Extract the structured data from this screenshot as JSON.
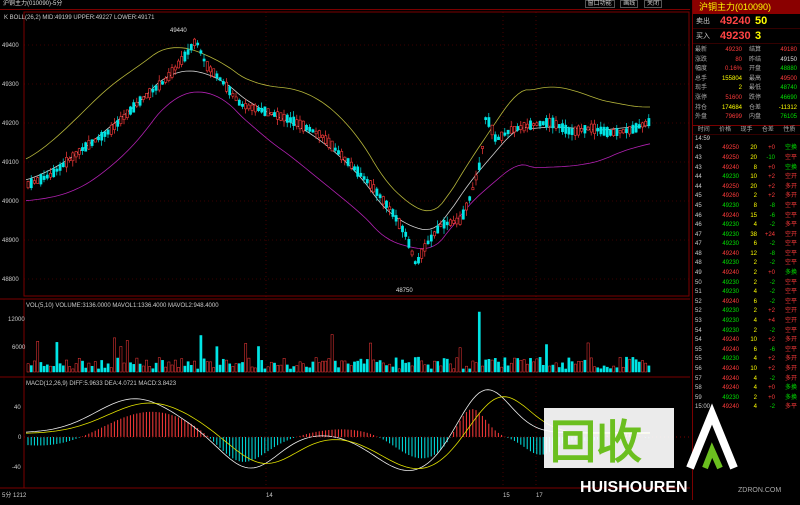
{
  "window": {
    "title": "沪铜主力(010090)-5分",
    "buttons": [
      "窗口功能",
      "画线",
      "关闭"
    ]
  },
  "main_chart": {
    "indicator_label": "K  BOLL(26,2) MID:49199 UPPER:49227 LOWER:49171",
    "y_ticks": [
      "49400",
      "49300",
      "49200",
      "49100",
      "49000",
      "48900",
      "48800"
    ],
    "high_label": "49440",
    "low_label": "48750"
  },
  "volume_chart": {
    "indicator_label": "VOL(5,10) VOLUME:3136.0000 MAVOL1:1336.4000 MAVOL2:948.4000",
    "y_ticks": [
      "12000",
      "6000"
    ]
  },
  "macd_chart": {
    "indicator_label": "MACD(12,26,9) DIFF:5.9633 DEA:4.0721 MACD:3.8423",
    "y_ticks": [
      "40",
      "0",
      "-40"
    ]
  },
  "x_axis": {
    "labels": [
      "5分 1212",
      "14",
      "15",
      "17"
    ]
  },
  "colors": {
    "up": "#ff3b3b",
    "down": "#00e5e5",
    "mid": "#d0d0d0",
    "upper": "#b5b53a",
    "lower": "#b020b0",
    "grid": "#7a0000",
    "accent": "#8a0000"
  },
  "panel": {
    "title": "沪铜主力(010090)",
    "sell": {
      "label": "卖出",
      "price": "49240",
      "vol": "50"
    },
    "buy": {
      "label": "买入",
      "price": "49230",
      "vol": "3"
    },
    "stats": [
      [
        "最新",
        "49230",
        "结算",
        "49180"
      ],
      [
        "涨跌",
        "80",
        "昨结",
        "49150"
      ],
      [
        "幅度",
        "0.16%",
        "开盘",
        "48880"
      ],
      [
        "总手",
        "155804",
        "最高",
        "49500"
      ],
      [
        "现手",
        "2",
        "最低",
        "48740"
      ],
      [
        "涨停",
        "51600",
        "跌停",
        "46690"
      ],
      [
        "持仓",
        "174684",
        "仓差",
        "-11312"
      ],
      [
        "外盘",
        "79699",
        "内盘",
        "76105"
      ]
    ],
    "ticks_header": [
      "时间",
      "价格",
      "现手",
      "仓差",
      "性质"
    ],
    "ticks": [
      [
        "14:59",
        "",
        "",
        "",
        ""
      ],
      [
        "43",
        "49250",
        "20",
        "+0",
        "空换"
      ],
      [
        "43",
        "49250",
        "20",
        "-10",
        "空平"
      ],
      [
        "43",
        "49240",
        "8",
        "+0",
        "空换"
      ],
      [
        "44",
        "49230",
        "10",
        "+2",
        "空开"
      ],
      [
        "44",
        "49250",
        "20",
        "+2",
        "多开"
      ],
      [
        "45",
        "49260",
        "2",
        "+2",
        "多开"
      ],
      [
        "45",
        "49230",
        "8",
        "-8",
        "空平"
      ],
      [
        "46",
        "49240",
        "15",
        "-6",
        "空平"
      ],
      [
        "46",
        "49230",
        "4",
        "-2",
        "多平"
      ],
      [
        "47",
        "49230",
        "38",
        "+24",
        "空开"
      ],
      [
        "47",
        "49230",
        "6",
        "-2",
        "空平"
      ],
      [
        "48",
        "49240",
        "12",
        "-8",
        "空平"
      ],
      [
        "48",
        "49230",
        "2",
        "-2",
        "空平"
      ],
      [
        "49",
        "49240",
        "2",
        "+0",
        "多换"
      ],
      [
        "50",
        "49230",
        "2",
        "-2",
        "空平"
      ],
      [
        "51",
        "49230",
        "4",
        "-2",
        "空平"
      ],
      [
        "52",
        "49240",
        "6",
        "-2",
        "空平"
      ],
      [
        "52",
        "49230",
        "2",
        "+2",
        "空开"
      ],
      [
        "53",
        "49230",
        "4",
        "+4",
        "空开"
      ],
      [
        "54",
        "49230",
        "2",
        "-2",
        "空平"
      ],
      [
        "54",
        "49240",
        "10",
        "+2",
        "多开"
      ],
      [
        "55",
        "49240",
        "6",
        "-6",
        "空平"
      ],
      [
        "55",
        "49230",
        "4",
        "+2",
        "多开"
      ],
      [
        "56",
        "49240",
        "10",
        "+2",
        "多开"
      ],
      [
        "57",
        "49240",
        "4",
        "-2",
        "多开"
      ],
      [
        "58",
        "49240",
        "4",
        "+0",
        "多换"
      ],
      [
        "59",
        "49230",
        "2",
        "+0",
        "多换"
      ],
      [
        "15:00",
        "49240",
        "4",
        "-2",
        "多平"
      ]
    ]
  },
  "watermark": {
    "cn": "回收",
    "en": "HUISHOUREN",
    "sub": "ZDRON.COM"
  }
}
